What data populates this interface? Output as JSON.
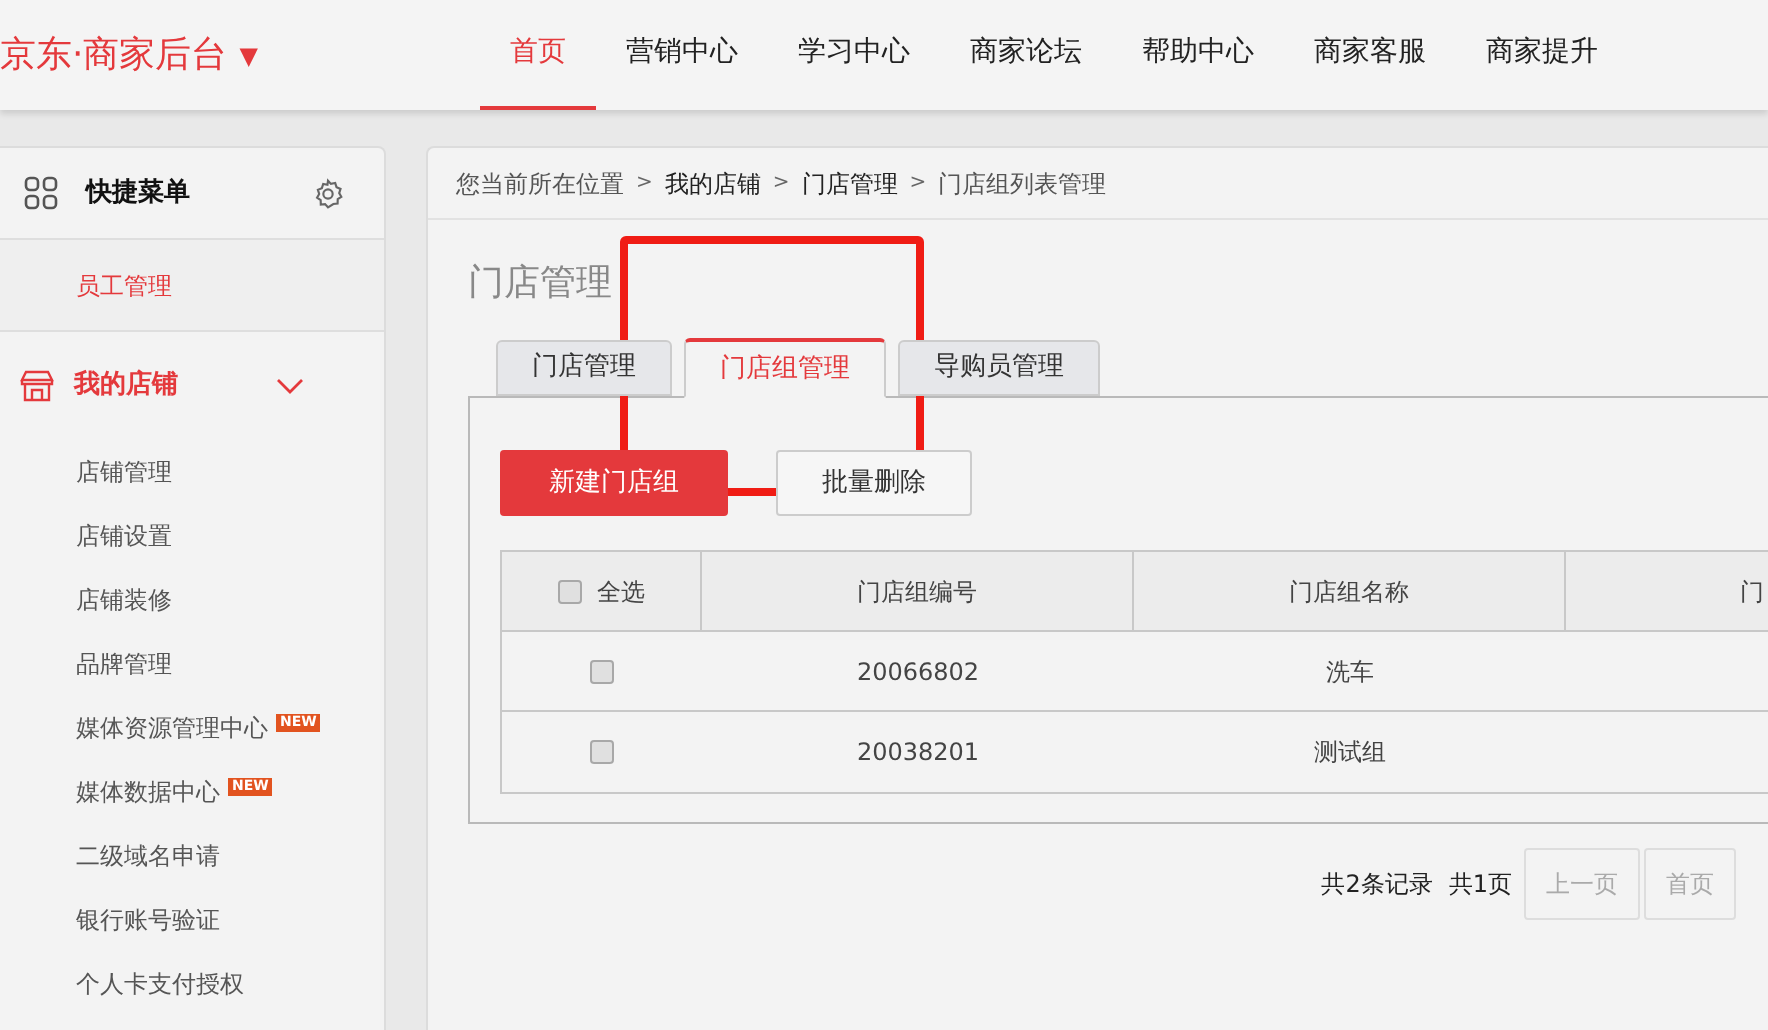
{
  "header": {
    "logo": "京东·商家后台",
    "logo_caret": "▼",
    "nav": [
      {
        "label": "首页",
        "selected": true
      },
      {
        "label": "营销中心",
        "selected": false
      },
      {
        "label": "学习中心",
        "selected": false
      },
      {
        "label": "商家论坛",
        "selected": false
      },
      {
        "label": "帮助中心",
        "selected": false
      },
      {
        "label": "商家客服",
        "selected": false
      },
      {
        "label": "商家提升",
        "selected": false
      }
    ]
  },
  "sidebar": {
    "title": "快捷菜单",
    "shortcuts": [
      {
        "label": "员工管理"
      }
    ],
    "section": {
      "label": "我的店铺",
      "expanded": true,
      "items": [
        {
          "label": "店铺管理"
        },
        {
          "label": "店铺设置"
        },
        {
          "label": "店铺装修"
        },
        {
          "label": "品牌管理"
        },
        {
          "label": "媒体资源管理中心",
          "badge": "NEW"
        },
        {
          "label": "媒体数据中心",
          "badge": "NEW"
        },
        {
          "label": "二级域名申请"
        },
        {
          "label": "银行账号验证"
        },
        {
          "label": "个人卡支付授权"
        }
      ]
    }
  },
  "breadcrumb": {
    "separator": ">",
    "items": [
      "您当前所在位置",
      "我的店铺",
      "门店管理",
      "门店组列表管理"
    ]
  },
  "page_title": "门店管理",
  "tabs": [
    {
      "label": "门店管理",
      "selected": false
    },
    {
      "label": "门店组管理",
      "selected": true
    },
    {
      "label": "导购员管理",
      "selected": false
    }
  ],
  "buttons": [
    {
      "label": "新建门店组",
      "kind": "primary"
    },
    {
      "label": "批量删除",
      "kind": "secondary"
    }
  ],
  "table": {
    "select_all": {
      "label": "全选",
      "checked": false
    },
    "columns": [
      "门店组编号",
      "门店组名称",
      "门"
    ],
    "rows": [
      {
        "checked": false,
        "cells": [
          "20066802",
          "洗车"
        ]
      },
      {
        "checked": false,
        "cells": [
          "20038201",
          "测试组"
        ]
      }
    ]
  },
  "pagination": {
    "total": "共2条记录",
    "pages": "共1页",
    "buttons": [
      {
        "label": "上一页",
        "disabled": true
      },
      {
        "label": "首页",
        "disabled": true
      }
    ]
  }
}
